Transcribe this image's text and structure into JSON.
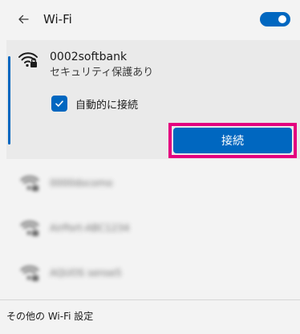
{
  "header": {
    "back_icon": "back-arrow-icon",
    "title": "Wi-Fi",
    "toggle_state": "on"
  },
  "selected_network": {
    "name": "0002softbank",
    "security": "セキュリティ保護あり",
    "auto_connect_label": "自動的に接続",
    "auto_connect_checked": true,
    "connect_label": "接続",
    "icon": "secured-wifi-icon"
  },
  "networks": [
    {
      "name": "0000docomo",
      "icon": "secured-wifi-icon"
    },
    {
      "name": "AirPort-ABC1234",
      "icon": "secured-wifi-icon"
    },
    {
      "name": "AQUOS sense5",
      "icon": "secured-wifi-icon"
    }
  ],
  "footer": {
    "more_settings_label": "その他の Wi-Fi 設定"
  },
  "colors": {
    "accent": "#0067c0",
    "highlight": "#e4007f",
    "background": "#f3f3f3",
    "selected_bg": "#eaeaea"
  }
}
